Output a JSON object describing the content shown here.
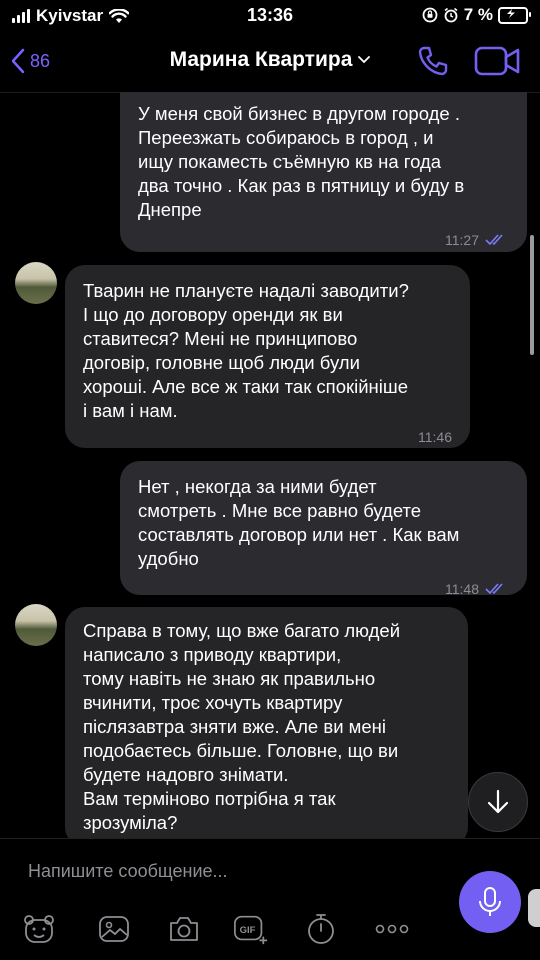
{
  "status_bar": {
    "carrier": "Kyivstar",
    "time": "13:36",
    "battery": "7 %"
  },
  "header": {
    "back_count": "86",
    "title": "Марина Квартира"
  },
  "messages": [
    {
      "direction": "outgoing",
      "text": "У меня свой бизнес в другом городе .\nПереезжать собираюсь в город , и\nищу покаместь съёмную кв на года\nдва точно . Как раз в пятницу и буду в\nДнепре",
      "time": "11:27",
      "read": true
    },
    {
      "direction": "incoming",
      "text": "Тварин не плануєте надалі заводити?\nІ що до договору оренди як ви\nставитеся? Мені не принципово\nдоговір, головне щоб люди були\nхороші. Але все ж таки так спокійніше\nі вам і нам.",
      "time": "11:46"
    },
    {
      "direction": "outgoing",
      "text": "Нет , некогда за ними будет\nсмотреть . Мне все равно будете\nсоставлять договор или нет . Как вам\nудобно",
      "time": "11:48",
      "read": true
    },
    {
      "direction": "incoming",
      "text": "Справа в тому, що вже багато людей\nнаписало з приводу квартири,\nтому навіть не знаю як правильно\nвчинити, троє хочуть квартиру\nпіслязавтра зняти вже. Але ви мені\nподобаєтесь більше. Головне, що ви\nбудете надовго знімати.\nВам терміново потрібна я так\nзрозуміла?",
      "time": ""
    }
  ],
  "composer": {
    "placeholder": "Напишите сообщение..."
  },
  "colors": {
    "accent": "#7360f2",
    "outgoing_bubble": "#2b2b30",
    "incoming_bubble": "#252528",
    "background": "#000000"
  },
  "toolbar_icons": [
    "sticker-icon",
    "gallery-icon",
    "camera-icon",
    "gif-icon",
    "timer-icon",
    "more-icon"
  ]
}
